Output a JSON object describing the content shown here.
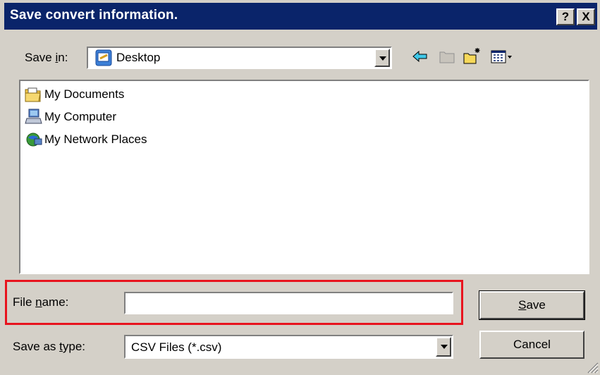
{
  "window": {
    "title": "Save convert information."
  },
  "title_buttons": {
    "help": "?",
    "close": "X"
  },
  "save_in": {
    "label_pre": "Save ",
    "label_key": "i",
    "label_post": "n:",
    "value": "Desktop"
  },
  "files": [
    {
      "name": "My Documents",
      "icon": "my-documents-icon"
    },
    {
      "name": "My Computer",
      "icon": "my-computer-icon"
    },
    {
      "name": "My Network Places",
      "icon": "network-places-icon"
    }
  ],
  "file_name": {
    "label_pre": "File ",
    "label_key": "n",
    "label_post": "ame:",
    "value": ""
  },
  "save_as_type": {
    "label_pre": "Save as ",
    "label_key": "t",
    "label_post": "ype:",
    "value": "CSV Files (*.csv)"
  },
  "buttons": {
    "save_key": "S",
    "save_rest": "ave",
    "cancel": "Cancel"
  },
  "colors": {
    "titlebar": "#0a246a",
    "face": "#d4d0c8",
    "highlight": "#e8141e"
  }
}
